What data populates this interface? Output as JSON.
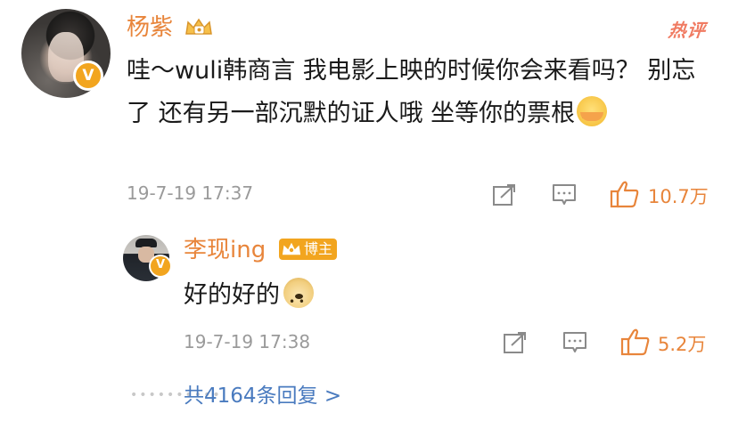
{
  "comment": {
    "author": "杨紫",
    "hot_label": "热评",
    "text": "哇～wuli韩商言 我电影上映的时候你会来看吗？ 别忘了 还有另一部沉默的证人哦 坐等你的票根",
    "emoji": "hug-emoji",
    "date": "19-7-19 17:37",
    "like_count": "10.7万",
    "badge_letter": "V"
  },
  "reply": {
    "author": "李现ing",
    "badge_label": "博主",
    "text": "好的好的",
    "emoji": "doge-emoji",
    "date": "19-7-19 17:38",
    "like_count": "5.2万",
    "badge_letter": "V"
  },
  "replies_link": "共4164条回复 >",
  "colors": {
    "name": "#e8853b",
    "link": "#4a7bbf",
    "meta": "#9a9a9a",
    "hot": "#f07b62",
    "badge": "#f2a51f"
  }
}
